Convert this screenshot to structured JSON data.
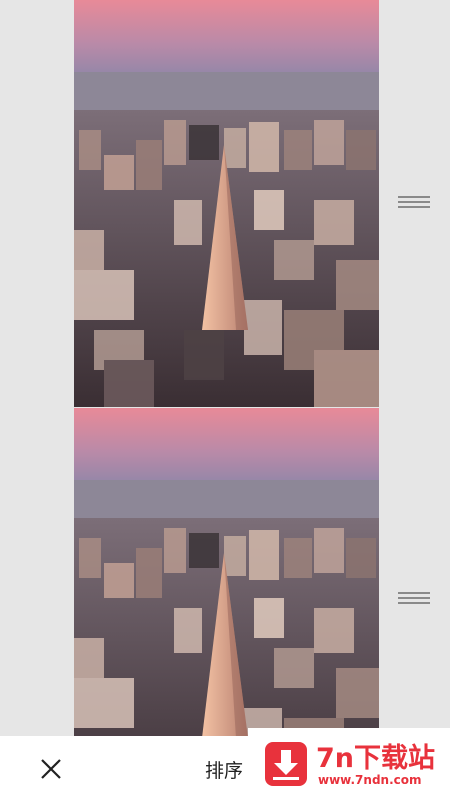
{
  "photos": [
    {
      "alt": "",
      "description_icon": "city-aerial-photo"
    },
    {
      "alt": "",
      "description_icon": "city-aerial-photo"
    }
  ],
  "bottom_bar": {
    "sort_label": "排序",
    "close_icon": "close-icon"
  },
  "watermark": {
    "title": "7n下载站",
    "url": "www.7ndn.com",
    "icon": "download-arrow-icon"
  },
  "colors": {
    "background": "#e6e6e6",
    "bar": "#ffffff",
    "handle": "#8a8a8a",
    "brand_red": "#e8323c"
  }
}
